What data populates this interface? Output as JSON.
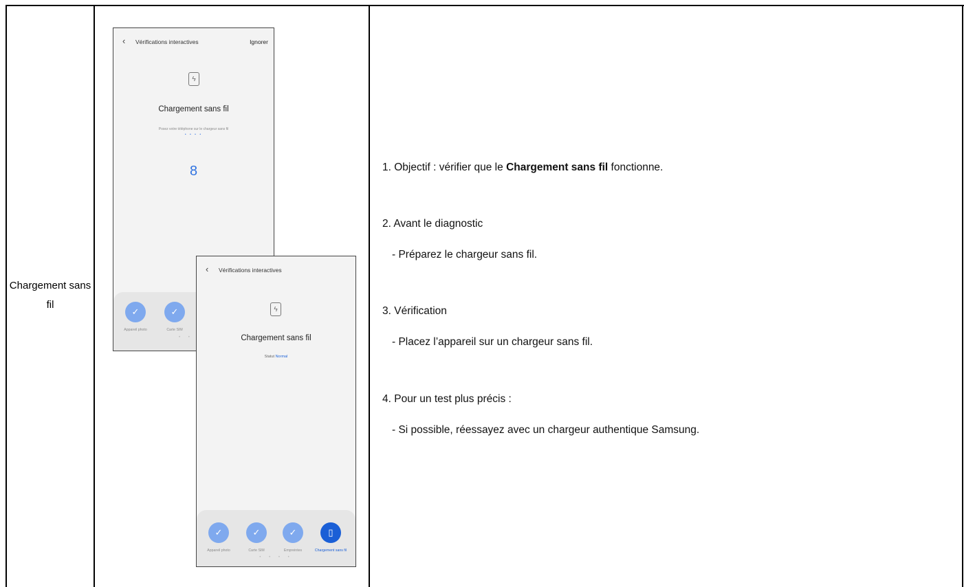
{
  "row_label": "Chargement sans fil",
  "screen_back": {
    "back_icon": "chevron-left-icon",
    "title": "Vérifications interactives",
    "skip": "Ignorer",
    "feature_icon": "wireless-charging-icon",
    "heading": "Chargement sans fil",
    "instruction": "Posez votre téléphone sur le chargeur sans fil",
    "progress_dots": "• • • •",
    "countdown": "8",
    "tray": [
      {
        "label": "Appareil photo",
        "icon": "check-icon"
      },
      {
        "label": "Carte SIM",
        "icon": "check-icon"
      }
    ],
    "pager": "• •"
  },
  "screen_front": {
    "back_icon": "chevron-left-icon",
    "title": "Vérifications interactives",
    "feature_icon": "wireless-charging-icon",
    "heading": "Chargement sans fil",
    "status_label": "Statut",
    "status_value": "Normal",
    "tray": [
      {
        "label": "Appareil photo",
        "icon": "check-icon"
      },
      {
        "label": "Carte SIM",
        "icon": "check-icon"
      },
      {
        "label": "Empreintes",
        "icon": "check-icon"
      },
      {
        "label": "Chargement sans fil",
        "icon": "wireless-charging-icon"
      }
    ],
    "pager": "• • • •"
  },
  "instructions": {
    "step1_prefix": "1. Objectif : vérifier que le ",
    "step1_bold": "Chargement sans fil",
    "step1_suffix": " fonctionne.",
    "step2_title": "2. Avant le diagnostic",
    "step2_item": "- Préparez le chargeur sans fil.",
    "step3_title": "3. Vérification",
    "step3_item": "- Placez l’appareil sur un chargeur sans fil.",
    "step4_title": "4. Pour un test plus précis :",
    "step4_item": "- Si possible, réessayez avec un chargeur authentique Samsung."
  }
}
